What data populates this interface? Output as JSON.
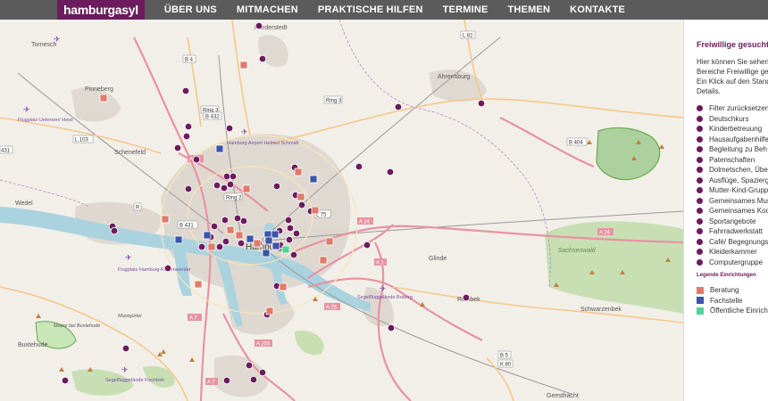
{
  "nav": {
    "logo": "hamburgasyl",
    "items": [
      "ÜBER UNS",
      "MITMACHEN",
      "PRAKTISCHE HILFEN",
      "TERMINE",
      "THEMEN",
      "KONTAKTE"
    ]
  },
  "panel": {
    "title": "Freiwillige gesucht",
    "description": [
      "Hier können Sie sehen,",
      "Bereiche Freiwillige ge",
      "Ein Klick auf den Stand",
      "Details."
    ],
    "categories": [
      "Filter zurücksetzen",
      "Deutschkurs",
      "Kinderbetreuung",
      "Hausaufgabenhilfe",
      "Begleitung zu Beh",
      "Patenschaften",
      "Dolmetschen, Über",
      "Ausflüge, Spazierg",
      "Mutter-Kind-Grupp",
      "Gemeinsames Mus",
      "Gemeinsames Koc",
      "Sportangebote",
      "Fahrradwerkstatt",
      "Café/ Begegnungs",
      "Kleiderkammer",
      "Computergruppe"
    ],
    "legend_title": "Legende Einrichtungen",
    "legend": [
      {
        "label": "Beratung",
        "color": "#e07a6b"
      },
      {
        "label": "Fachstelle",
        "color": "#3b55a8"
      },
      {
        "label": "Öffentliche Einrich",
        "color": "#4fd39a"
      }
    ]
  },
  "colors": {
    "accent": "#6b1b5e",
    "nav_bg": "#5b5b5b",
    "water": "#aad3df",
    "motorway": "#e892a2",
    "primary": "#fcd6a4",
    "forest": "#add19e"
  },
  "map": {
    "places": [
      "Tornesch",
      "Norderstedt",
      "Pinneberg",
      "Ahrensburg",
      "Flugplatz Uetersen/ Heist",
      "Hamburg Airport Helmut Schmidt",
      "Schenefeld",
      "Wedel",
      "Hamburg",
      "Flugplatz Hamburg-Finkenwerder",
      "Glinde",
      "Sachsenwald",
      "Reinbek",
      "Schwarzenbek",
      "Buxtehude",
      "Moorgürtel",
      "Moore bei Buxtehude",
      "Segelfluggelände Boberg",
      "Segelfluggelände Fischbek",
      "Geesthacht"
    ],
    "road_labels": [
      "B 4",
      "L 82",
      "Ring 3",
      "B 432",
      "Ring 3",
      "L 103",
      "431",
      "A 23",
      "Ring 2",
      "B 431",
      "A 7",
      "A 24",
      "L 75",
      "A 1",
      "A 25",
      "A 24",
      "B 404",
      "A 253",
      "B 5",
      "K 80",
      "A 7",
      "R"
    ]
  }
}
